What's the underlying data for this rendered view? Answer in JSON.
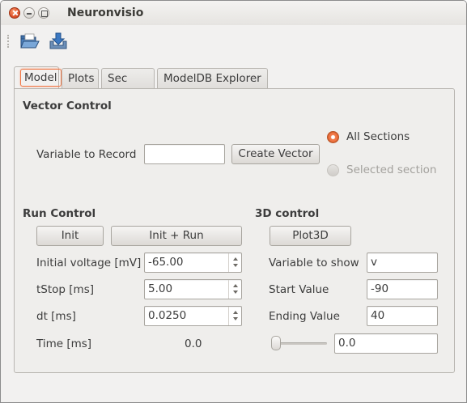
{
  "window": {
    "title": "Neuronvisio"
  },
  "toolbar": {
    "open_icon": "folder-open-icon",
    "save_icon": "save-icon"
  },
  "tabs": [
    {
      "label": "Model",
      "active": true
    },
    {
      "label": "Plots",
      "active": false
    },
    {
      "label": "Sec Info",
      "active": false
    },
    {
      "label": "ModelDB Explorer",
      "active": false
    }
  ],
  "vector_control": {
    "header": "Vector Control",
    "variable_label": "Variable to Record",
    "variable_value": "",
    "create_button": "Create Vector",
    "radio_all": "All Sections",
    "radio_selected": "Selected section",
    "selected_option": "All Sections"
  },
  "run_control": {
    "header": "Run Control",
    "init_button": "Init",
    "init_run_button": "Init + Run",
    "initial_voltage_label": "Initial voltage [mV]",
    "initial_voltage_value": "-65.00",
    "tstop_label": "tStop [ms]",
    "tstop_value": "5.00",
    "dt_label": "dt [ms]",
    "dt_value": "0.0250",
    "time_label": "Time [ms]",
    "time_value": "0.0"
  },
  "control_3d": {
    "header": "3D control",
    "plot_button": "Plot3D",
    "variable_label": "Variable to show",
    "variable_value": "v",
    "start_label": "Start Value",
    "start_value": "-90",
    "end_label": "Ending Value",
    "end_value": "40",
    "slider_value": "0.0",
    "slider_fraction": 0
  },
  "colors": {
    "accent": "#f07746",
    "window_bg": "#f2f1f0"
  }
}
